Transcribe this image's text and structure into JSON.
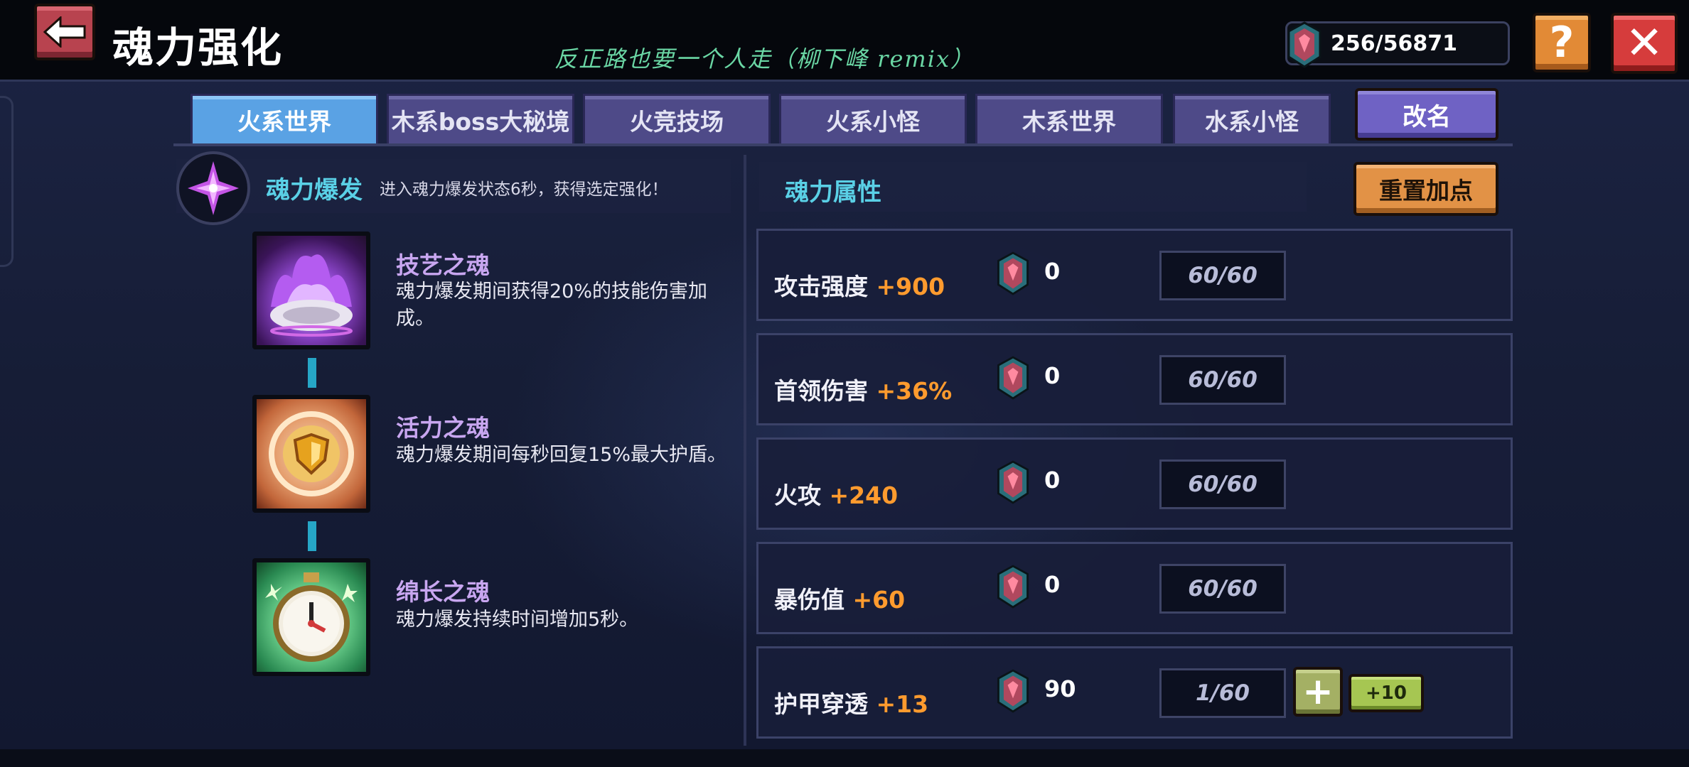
{
  "header": {
    "title": "魂力强化",
    "song_caption": "反正路也要一个人走（柳下峰 remix）",
    "currency": "256/56871"
  },
  "tabs": [
    {
      "label": "火系世界",
      "active": true
    },
    {
      "label": "木系boss大秘境",
      "active": false
    },
    {
      "label": "火竞技场",
      "active": false
    },
    {
      "label": "火系小怪",
      "active": false
    },
    {
      "label": "木系世界",
      "active": false
    },
    {
      "label": "水系小怪",
      "active": false
    }
  ],
  "rename_label": "改名",
  "burst": {
    "title": "魂力爆发",
    "description": "进入魂力爆发状态6秒，获得选定强化！"
  },
  "souls": [
    {
      "name": "技艺之魂",
      "description": "魂力爆发期间获得20%的技能伤害加成。",
      "icon": "purple-flame-icon"
    },
    {
      "name": "活力之魂",
      "description": "魂力爆发期间每秒回复15%最大护盾。",
      "icon": "shield-emblem-icon"
    },
    {
      "name": "绵长之魂",
      "description": "魂力爆发持续时间增加5秒。",
      "icon": "stopwatch-icon"
    }
  ],
  "attributes_panel": {
    "title": "魂力属性",
    "reset_label": "重置加点",
    "plus_label": "+",
    "plus10_label": "+10"
  },
  "attributes": [
    {
      "name": "攻击强度",
      "bonus": "+900",
      "cost": "0",
      "level": "60/60"
    },
    {
      "name": "首领伤害",
      "bonus": "+36%",
      "cost": "0",
      "level": "60/60"
    },
    {
      "name": "火攻",
      "bonus": "+240",
      "cost": "0",
      "level": "60/60"
    },
    {
      "name": "暴伤值",
      "bonus": "+60",
      "cost": "0",
      "level": "60/60"
    },
    {
      "name": "护甲穿透",
      "bonus": "+13",
      "cost": "90",
      "level": "1/60"
    }
  ],
  "colors": {
    "accent_cyan": "#5ad0e6",
    "bonus_orange": "#ff9b2e",
    "active_tab": "#5aa2e4",
    "inactive_tab": "#4e4a88"
  }
}
